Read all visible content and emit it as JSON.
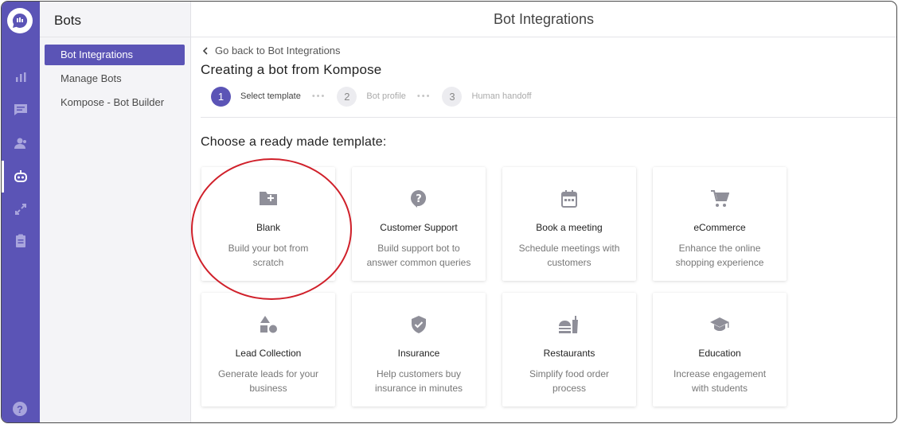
{
  "subnav": {
    "title": "Bots",
    "items": [
      {
        "label": "Bot Integrations",
        "active": true
      },
      {
        "label": "Manage Bots",
        "active": false
      },
      {
        "label": "Kompose - Bot Builder",
        "active": false
      }
    ]
  },
  "topbar": {
    "title": "Bot Integrations"
  },
  "back": {
    "label": "Go back to Bot Integrations"
  },
  "heading": "Creating a bot from Kompose",
  "steps": [
    {
      "number": "1",
      "label": "Select template",
      "active": true
    },
    {
      "number": "2",
      "label": "Bot profile",
      "active": false
    },
    {
      "number": "3",
      "label": "Human handoff",
      "active": false
    }
  ],
  "choose_label": "Choose a ready made template:",
  "templates": [
    {
      "icon": "folder-plus-icon",
      "name": "Blank",
      "desc": "Build your bot from scratch"
    },
    {
      "icon": "question-bubble-icon",
      "name": "Customer Support",
      "desc": "Build support bot to answer common queries"
    },
    {
      "icon": "calendar-icon",
      "name": "Book a meeting",
      "desc": "Schedule meetings with customers"
    },
    {
      "icon": "cart-icon",
      "name": "eCommerce",
      "desc": "Enhance the online shopping experience"
    },
    {
      "icon": "shapes-icon",
      "name": "Lead Collection",
      "desc": "Generate leads for your business"
    },
    {
      "icon": "shield-check-icon",
      "name": "Insurance",
      "desc": "Help customers buy insurance in minutes"
    },
    {
      "icon": "food-icon",
      "name": "Restaurants",
      "desc": "Simplify food order process"
    },
    {
      "icon": "graduation-cap-icon",
      "name": "Education",
      "desc": "Increase engagement with students"
    }
  ],
  "rail": {
    "icons": [
      "chat-logo-icon",
      "bar-chart-icon",
      "conversations-icon",
      "users-icon",
      "bot-icon",
      "integrations-icon",
      "reports-icon",
      "help-icon"
    ],
    "help_glyph": "?"
  },
  "colors": {
    "accent": "#5b54b6",
    "highlight": "#d0202a"
  }
}
